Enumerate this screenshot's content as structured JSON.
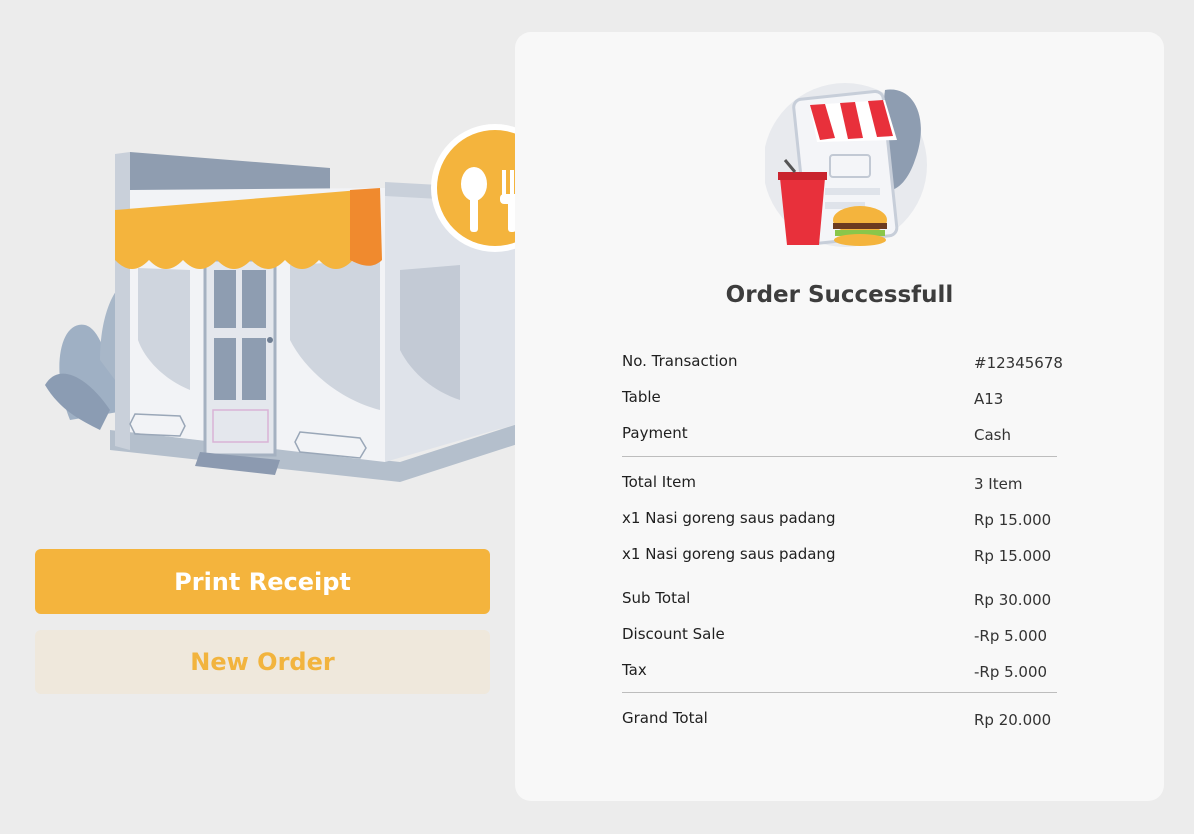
{
  "actions": {
    "print_receipt_label": "Print Receipt",
    "new_order_label": "New Order"
  },
  "receipt": {
    "title": "Order Successfull",
    "info": [
      {
        "label": "No. Transaction",
        "value": "#12345678"
      },
      {
        "label": "Table",
        "value": "A13"
      },
      {
        "label": "Payment",
        "value": "Cash"
      }
    ],
    "items_summary": {
      "label": "Total Item",
      "value": "3 Item"
    },
    "items": [
      {
        "label": "x1 Nasi goreng saus padang",
        "value": "Rp 15.000"
      },
      {
        "label": "x1 Nasi goreng saus padang",
        "value": "Rp 15.000"
      }
    ],
    "totals": [
      {
        "label": "Sub Total",
        "value": "Rp 30.000"
      },
      {
        "label": "Discount Sale",
        "value": "-Rp 5.000"
      },
      {
        "label": "Tax",
        "value": "-Rp 5.000"
      }
    ],
    "grand_total": {
      "label": "Grand Total",
      "value": "Rp 20.000"
    }
  },
  "colors": {
    "accent": "#f4b43d",
    "accent_soft": "#efe8dc",
    "card_bg": "#f8f8f8",
    "page_bg": "#ececec"
  },
  "icons": [
    "store-illustration",
    "restaurant-sign-icon",
    "food-delivery-illustration"
  ]
}
